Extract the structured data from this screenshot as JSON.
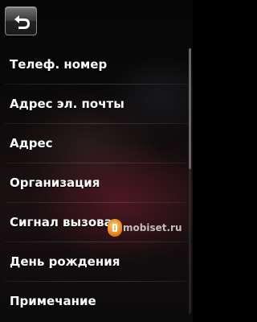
{
  "header": {
    "back_icon": "back-arrow-icon"
  },
  "menu": {
    "items": [
      {
        "label": "Телеф. номер"
      },
      {
        "label": "Адрес эл. почты"
      },
      {
        "label": "Адрес"
      },
      {
        "label": "Организация"
      },
      {
        "label": "Сигнал вызова"
      },
      {
        "label": "День рождения"
      },
      {
        "label": "Примечание"
      }
    ]
  },
  "watermark": {
    "text": "mobiset.ru"
  },
  "colors": {
    "text": "#ffffff",
    "button_top": "#707070",
    "button_bottom": "#1a1a1a",
    "watermark_accent": "#e07a10"
  }
}
